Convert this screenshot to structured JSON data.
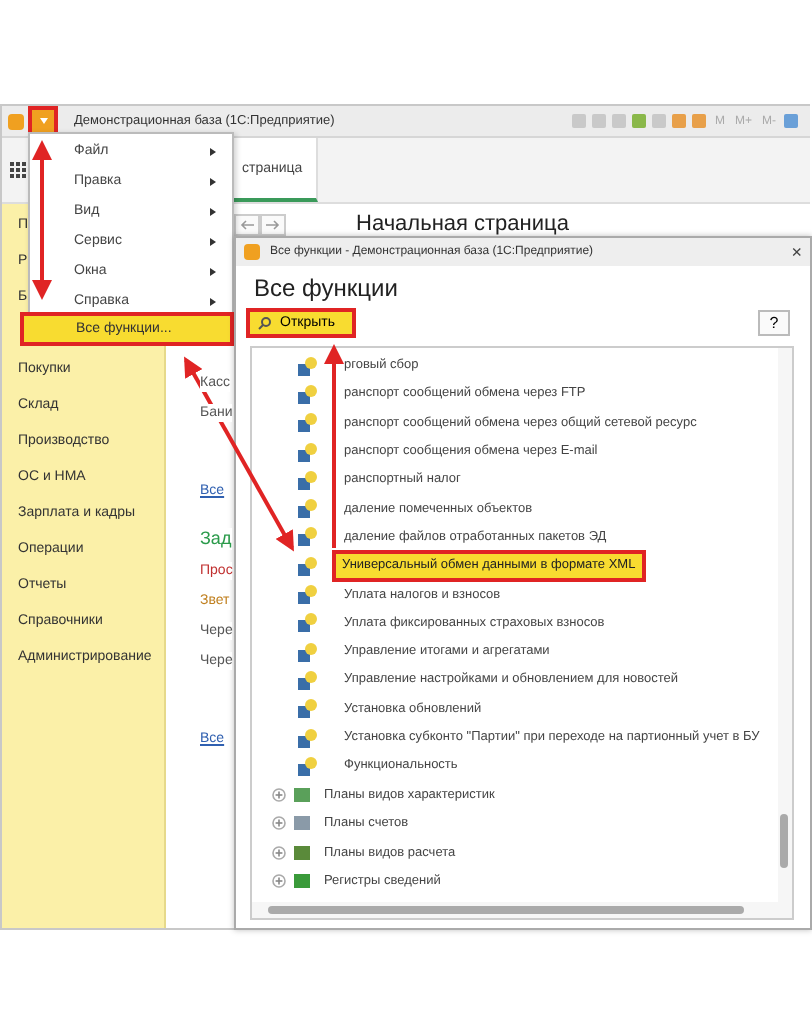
{
  "main_window": {
    "title": "Демонстрационная база (1С:Предприятие)",
    "menu_button_highlighted": true,
    "memory_buttons": [
      "M",
      "M+",
      "M-"
    ],
    "tab": "страница",
    "page_title": "Начальная страница"
  },
  "sidebar": {
    "items_top": [
      "П",
      "Р",
      "Б"
    ],
    "items": [
      "Покупки",
      "Склад",
      "Производство",
      "ОС и НМА",
      "Зарплата и кадры",
      "Операции",
      "Отчеты",
      "Справочники",
      "Администрирование"
    ]
  },
  "content": [
    {
      "text": "Касс",
      "kind": "text"
    },
    {
      "text": "Бани",
      "kind": "text"
    },
    {
      "text": "Все",
      "kind": "link"
    },
    {
      "text": "Зад",
      "kind": "heading"
    },
    {
      "text": "Прос",
      "kind": "alert"
    },
    {
      "text": "Звет",
      "kind": "warning"
    },
    {
      "text": "Чере",
      "kind": "text"
    },
    {
      "text": "Чере",
      "kind": "text"
    },
    {
      "text": "Все",
      "kind": "link"
    }
  ],
  "main_menu": {
    "items": [
      {
        "label": "Файл",
        "submenu": true
      },
      {
        "label": "Правка",
        "submenu": true
      },
      {
        "label": "Вид",
        "submenu": true
      },
      {
        "label": "Сервис",
        "submenu": true
      },
      {
        "label": "Окна",
        "submenu": true
      },
      {
        "label": "Справка",
        "submenu": true
      }
    ],
    "all_functions": {
      "label": "Все функции...",
      "highlighted": true
    }
  },
  "dialog": {
    "title": "Все функции - Демонстрационная база (1С:Предприятие)",
    "close": "×",
    "heading": "Все функции",
    "open_button": {
      "label": "Открыть",
      "highlighted": true
    },
    "help_button": "?",
    "items": [
      {
        "kind": "function",
        "label": "рговый сбор",
        "highlighted": false
      },
      {
        "kind": "function",
        "label": "ранспорт сообщений обмена через FTP",
        "highlighted": false
      },
      {
        "kind": "function",
        "label": "ранспорт сообщений обмена через общий сетевой ресурс",
        "highlighted": false
      },
      {
        "kind": "function",
        "label": "ранспорт сообщения обмена через E-mail",
        "highlighted": false
      },
      {
        "kind": "function",
        "label": "ранспортный налог",
        "highlighted": false
      },
      {
        "kind": "function",
        "label": "даление помеченных объектов",
        "highlighted": false
      },
      {
        "kind": "function",
        "label": "даление файлов отработанных пакетов ЭД",
        "highlighted": false
      },
      {
        "kind": "function",
        "label": "Универсальный обмен данными в формате XML",
        "highlighted": true
      },
      {
        "kind": "function",
        "label": "Уплата налогов и взносов",
        "highlighted": false
      },
      {
        "kind": "function",
        "label": "Уплата фиксированных страховых взносов",
        "highlighted": false
      },
      {
        "kind": "function",
        "label": "Управление итогами и агрегатами",
        "highlighted": false
      },
      {
        "kind": "function",
        "label": "Управление настройками и обновлением для новостей",
        "highlighted": false
      },
      {
        "kind": "function",
        "label": "Установка обновлений",
        "highlighted": false
      },
      {
        "kind": "function",
        "label": "Установка субконто \"Партии\" при переходе на партионный учет в БУ",
        "highlighted": false
      },
      {
        "kind": "function",
        "label": "Функциональность",
        "highlighted": false
      },
      {
        "kind": "group",
        "label": "Планы видов характеристик",
        "expanded": false
      },
      {
        "kind": "group",
        "label": "Планы счетов",
        "expanded": false
      },
      {
        "kind": "group",
        "label": "Планы видов расчета",
        "expanded": false
      },
      {
        "kind": "group",
        "label": "Регистры сведений",
        "expanded": false
      }
    ]
  }
}
